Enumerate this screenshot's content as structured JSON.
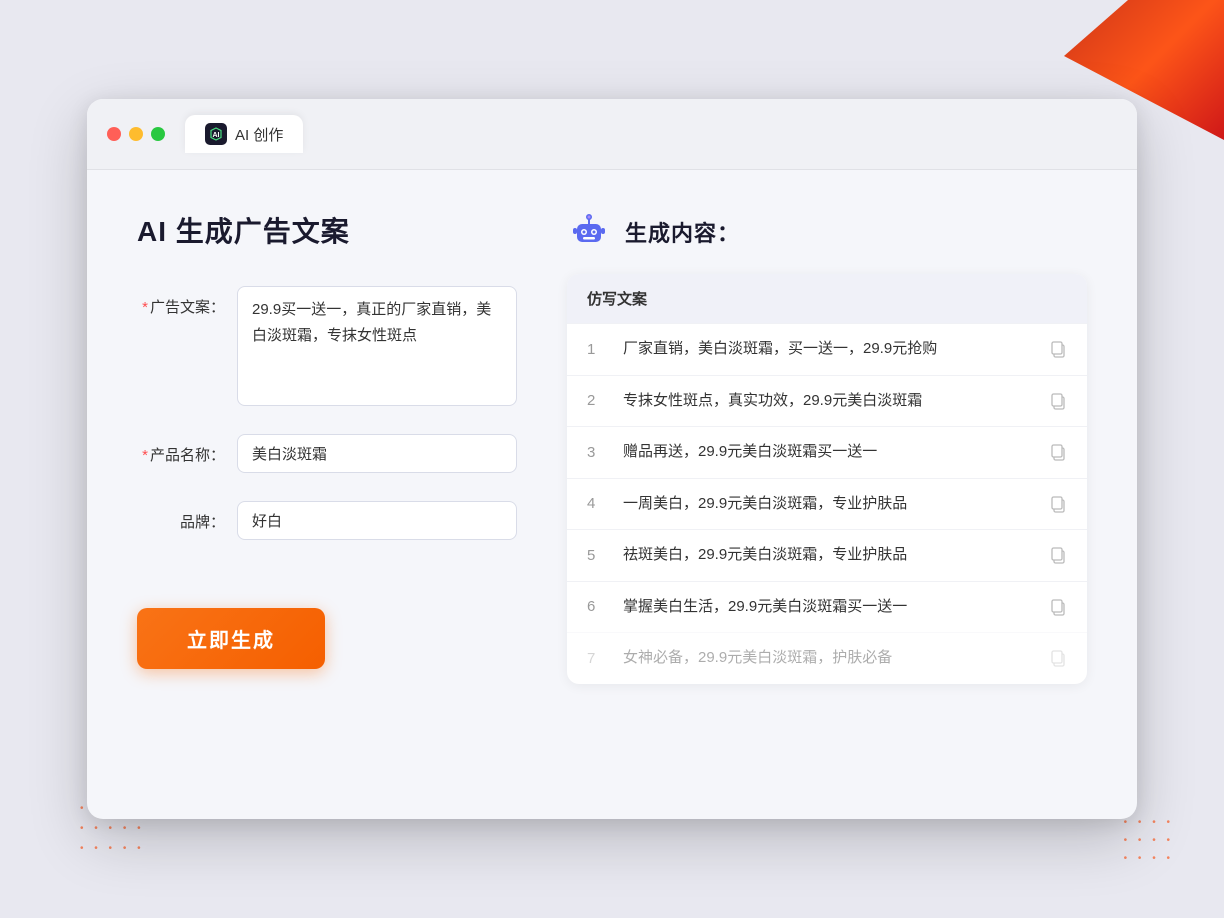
{
  "browser": {
    "tab_title": "AI 创作",
    "tab_icon_text": "AI"
  },
  "page": {
    "title": "AI 生成广告文案"
  },
  "form": {
    "ad_copy_label": "广告文案：",
    "ad_copy_required": "*",
    "ad_copy_value": "29.9买一送一，真正的厂家直销，美白淡斑霜，专抹女性斑点",
    "product_name_label": "产品名称：",
    "product_name_required": "*",
    "product_name_value": "美白淡斑霜",
    "brand_label": "品牌：",
    "brand_value": "好白",
    "generate_button": "立即生成"
  },
  "result": {
    "header_title": "生成内容：",
    "table_column": "仿写文案",
    "items": [
      {
        "id": 1,
        "text": "厂家直销，美白淡斑霜，买一送一，29.9元抢购"
      },
      {
        "id": 2,
        "text": "专抹女性斑点，真实功效，29.9元美白淡斑霜"
      },
      {
        "id": 3,
        "text": "赠品再送，29.9元美白淡斑霜买一送一"
      },
      {
        "id": 4,
        "text": "一周美白，29.9元美白淡斑霜，专业护肤品"
      },
      {
        "id": 5,
        "text": "祛斑美白，29.9元美白淡斑霜，专业护肤品"
      },
      {
        "id": 6,
        "text": "掌握美白生活，29.9元美白淡斑霜买一送一"
      },
      {
        "id": 7,
        "text": "女神必备，29.9元美白淡斑霜，护肤必备",
        "dimmed": true
      }
    ]
  }
}
